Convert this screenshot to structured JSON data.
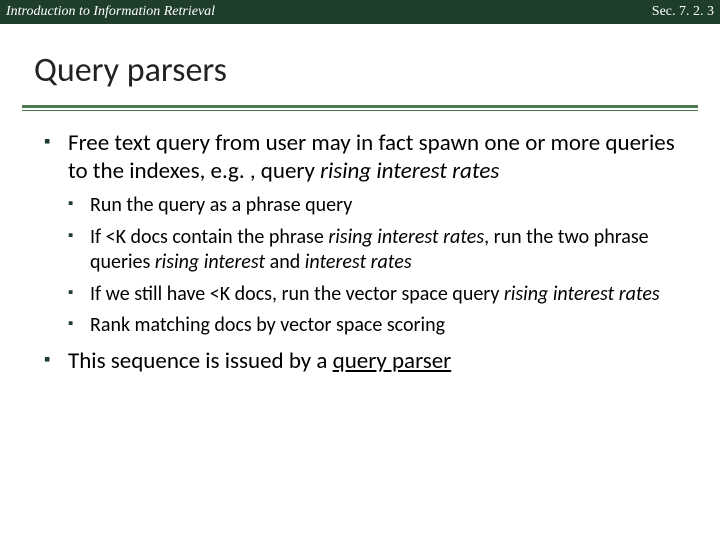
{
  "header": {
    "left": "Introduction to Information Retrieval",
    "right": "Sec. 7. 2. 3"
  },
  "title": "Query parsers",
  "body": {
    "b1_pre": "Free text query from user may in fact spawn one or more queries to the indexes, e.g. , query ",
    "b1_ital": "rising interest rates",
    "sub1": "Run the query as a phrase query",
    "sub2_a": "If <K docs contain the phrase ",
    "sub2_b": "rising interest rates",
    "sub2_c": ", run the two phrase queries ",
    "sub2_d": "rising interest",
    "sub2_e": " and ",
    "sub2_f": "interest rates",
    "sub3_a": "If we still have <K docs, run the vector space query ",
    "sub3_b": "rising interest rates",
    "sub4": "Rank matching docs by vector space scoring",
    "b2_a": "This sequence is issued by a ",
    "b2_b": "query parser"
  }
}
